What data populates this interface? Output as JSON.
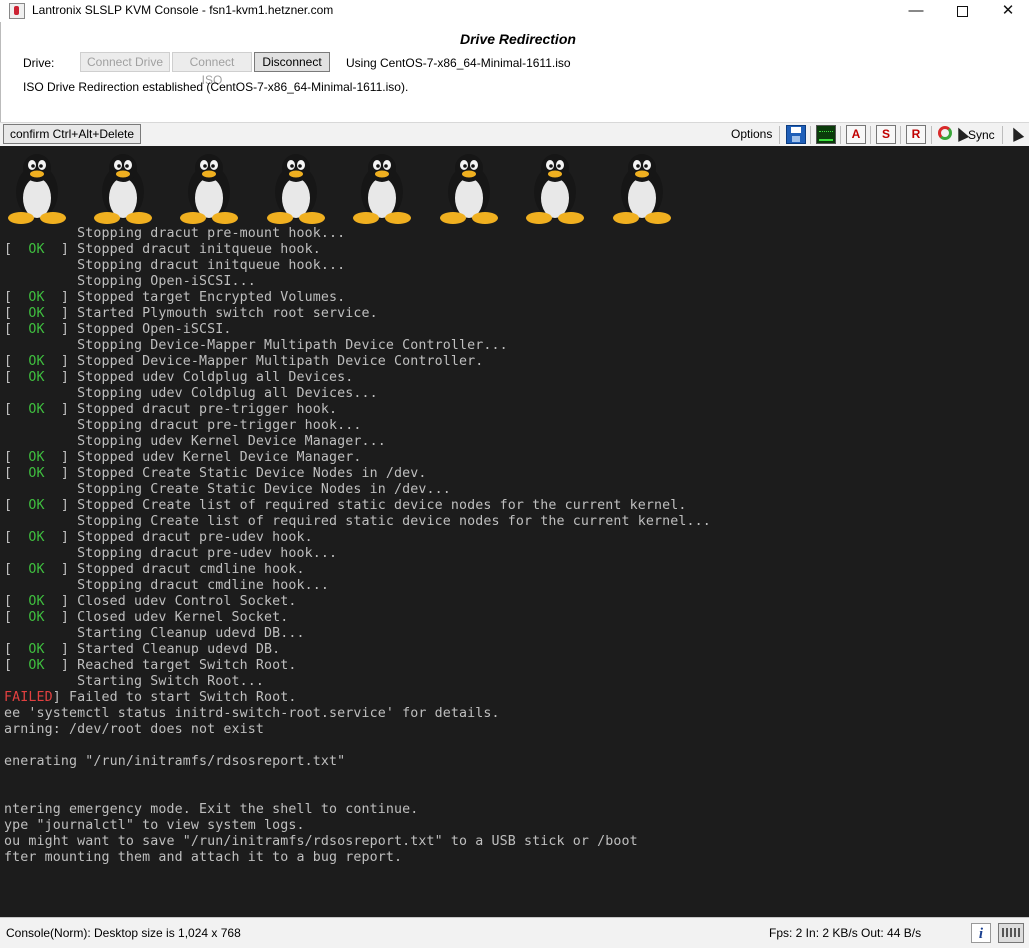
{
  "window": {
    "title": "Lantronix SLSLP KVM Console - fsn1-kvm1.hetzner.com",
    "minimize": "—",
    "close": "✕"
  },
  "drive": {
    "title": "Drive Redirection",
    "label": "Drive:",
    "connect_drive": "Connect Drive",
    "connect_iso": "Connect ISO",
    "disconnect": "Disconnect",
    "using": "Using CentOS-7-x86_64-Minimal-1611.iso",
    "status": "ISO Drive Redirection established (CentOS-7-x86_64-Minimal-1611.iso)."
  },
  "toolbar": {
    "cad_label": "confirm Ctrl+Alt+Delete",
    "options_label": "Options",
    "icon_a": "A",
    "icon_s": "S",
    "icon_r": "R",
    "sync_label": "Sync"
  },
  "console": {
    "lines": [
      {
        "pre": "",
        "tag": "",
        "text": "         Stopping dracut pre-mount hook..."
      },
      {
        "pre": "[  ",
        "tag": "OK",
        "text": "  ] Stopped dracut initqueue hook."
      },
      {
        "pre": "",
        "tag": "",
        "text": "         Stopping dracut initqueue hook..."
      },
      {
        "pre": "",
        "tag": "",
        "text": "         Stopping Open-iSCSI..."
      },
      {
        "pre": "[  ",
        "tag": "OK",
        "text": "  ] Stopped target Encrypted Volumes."
      },
      {
        "pre": "[  ",
        "tag": "OK",
        "text": "  ] Started Plymouth switch root service."
      },
      {
        "pre": "[  ",
        "tag": "OK",
        "text": "  ] Stopped Open-iSCSI."
      },
      {
        "pre": "",
        "tag": "",
        "text": "         Stopping Device-Mapper Multipath Device Controller..."
      },
      {
        "pre": "[  ",
        "tag": "OK",
        "text": "  ] Stopped Device-Mapper Multipath Device Controller."
      },
      {
        "pre": "[  ",
        "tag": "OK",
        "text": "  ] Stopped udev Coldplug all Devices."
      },
      {
        "pre": "",
        "tag": "",
        "text": "         Stopping udev Coldplug all Devices..."
      },
      {
        "pre": "[  ",
        "tag": "OK",
        "text": "  ] Stopped dracut pre-trigger hook."
      },
      {
        "pre": "",
        "tag": "",
        "text": "         Stopping dracut pre-trigger hook..."
      },
      {
        "pre": "",
        "tag": "",
        "text": "         Stopping udev Kernel Device Manager..."
      },
      {
        "pre": "[  ",
        "tag": "OK",
        "text": "  ] Stopped udev Kernel Device Manager."
      },
      {
        "pre": "[  ",
        "tag": "OK",
        "text": "  ] Stopped Create Static Device Nodes in /dev."
      },
      {
        "pre": "",
        "tag": "",
        "text": "         Stopping Create Static Device Nodes in /dev..."
      },
      {
        "pre": "[  ",
        "tag": "OK",
        "text": "  ] Stopped Create list of required static device nodes for the current kernel."
      },
      {
        "pre": "",
        "tag": "",
        "text": "         Stopping Create list of required static device nodes for the current kernel..."
      },
      {
        "pre": "[  ",
        "tag": "OK",
        "text": "  ] Stopped dracut pre-udev hook."
      },
      {
        "pre": "",
        "tag": "",
        "text": "         Stopping dracut pre-udev hook..."
      },
      {
        "pre": "[  ",
        "tag": "OK",
        "text": "  ] Stopped dracut cmdline hook."
      },
      {
        "pre": "",
        "tag": "",
        "text": "         Stopping dracut cmdline hook..."
      },
      {
        "pre": "[  ",
        "tag": "OK",
        "text": "  ] Closed udev Control Socket."
      },
      {
        "pre": "[  ",
        "tag": "OK",
        "text": "  ] Closed udev Kernel Socket."
      },
      {
        "pre": "",
        "tag": "",
        "text": "         Starting Cleanup udevd DB..."
      },
      {
        "pre": "[  ",
        "tag": "OK",
        "text": "  ] Started Cleanup udevd DB."
      },
      {
        "pre": "[  ",
        "tag": "OK",
        "text": "  ] Reached target Switch Root."
      },
      {
        "pre": "",
        "tag": "",
        "text": "         Starting Switch Root..."
      },
      {
        "pre": "",
        "tag": "FAILED",
        "text": "] Failed to start Switch Root."
      },
      {
        "pre": "",
        "tag": "",
        "text": "ee 'systemctl status initrd-switch-root.service' for details."
      },
      {
        "pre": "",
        "tag": "",
        "text": "arning: /dev/root does not exist"
      },
      {
        "pre": "",
        "tag": "",
        "text": ""
      },
      {
        "pre": "",
        "tag": "",
        "text": "enerating \"/run/initramfs/rdsosreport.txt\""
      },
      {
        "pre": "",
        "tag": "",
        "text": ""
      },
      {
        "pre": "",
        "tag": "",
        "text": ""
      },
      {
        "pre": "",
        "tag": "",
        "text": "ntering emergency mode. Exit the shell to continue."
      },
      {
        "pre": "",
        "tag": "",
        "text": "ype \"journalctl\" to view system logs."
      },
      {
        "pre": "",
        "tag": "",
        "text": "ou might want to save \"/run/initramfs/rdsosreport.txt\" to a USB stick or /boot"
      },
      {
        "pre": "",
        "tag": "",
        "text": "fter mounting them and attach it to a bug report."
      },
      {
        "pre": "",
        "tag": "",
        "text": ""
      },
      {
        "pre": "",
        "tag": "",
        "text": ""
      },
      {
        "pre": "",
        "tag": "",
        "text": ""
      },
      {
        "pre": "",
        "tag": "",
        "text": ""
      },
      {
        "pre": "",
        "tag": "",
        "text": "/#"
      }
    ]
  },
  "statusbar": {
    "left": "Console(Norm): Desktop size is 1,024 x 768",
    "right": "Fps: 2 In: 2 KB/s Out: 44 B/s",
    "info_glyph": "i"
  },
  "colors": {
    "console_bg": "#1c1c1c",
    "console_text": "#bfbfbf",
    "ok_green": "#3fbf3f",
    "failed_red": "#e24040"
  },
  "icons": [
    "save-icon",
    "performance-icon",
    "macro-a-icon",
    "macro-s-icon",
    "macro-r-icon",
    "sync-icon",
    "cursor-icon",
    "info-icon",
    "keyboard-icon"
  ]
}
